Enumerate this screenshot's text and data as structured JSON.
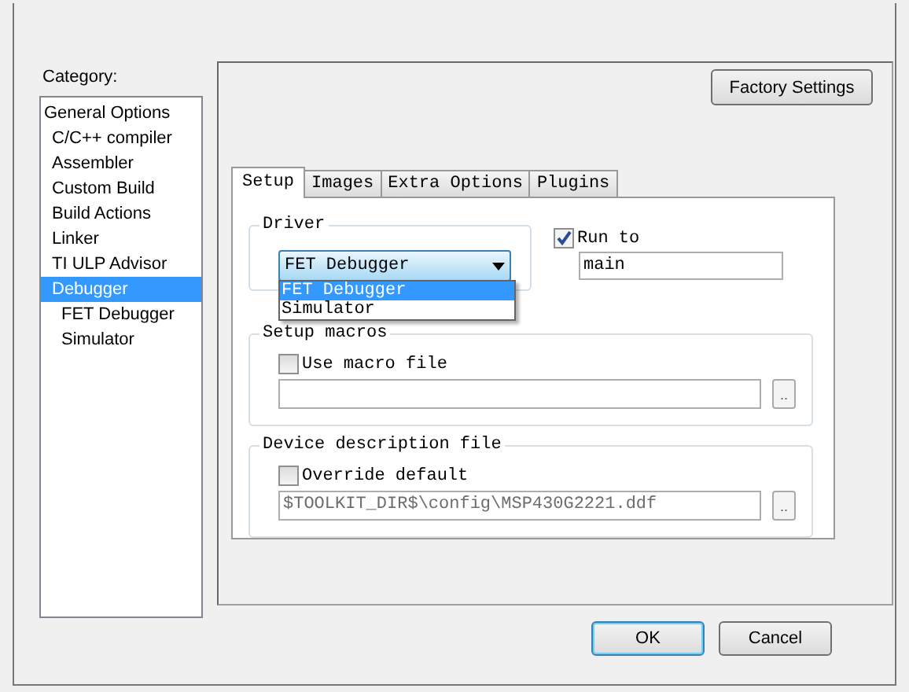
{
  "category": {
    "label": "Category:",
    "items": [
      {
        "label": "General Options",
        "selected": false,
        "children": [
          {
            "label": "C/C++ compiler",
            "selected": false
          },
          {
            "label": "Assembler",
            "selected": false
          },
          {
            "label": "Custom Build",
            "selected": false
          },
          {
            "label": "Build Actions",
            "selected": false
          },
          {
            "label": "Linker",
            "selected": false
          },
          {
            "label": "TI ULP Advisor",
            "selected": false
          },
          {
            "label": "Debugger",
            "selected": true,
            "children": [
              {
                "label": "FET Debugger",
                "selected": false
              },
              {
                "label": "Simulator",
                "selected": false
              }
            ]
          }
        ]
      }
    ]
  },
  "factory_button": "Factory Settings",
  "tabs": [
    {
      "label": "Setup",
      "selected": true
    },
    {
      "label": "Images",
      "selected": false
    },
    {
      "label": "Extra Options",
      "selected": false
    },
    {
      "label": "Plugins",
      "selected": false
    }
  ],
  "driver": {
    "legend": "Driver",
    "value": "FET Debugger",
    "options": [
      {
        "label": "FET Debugger",
        "selected": true
      },
      {
        "label": "Simulator",
        "selected": false
      }
    ]
  },
  "run_to": {
    "label": "Run to",
    "checked": true,
    "value": "main"
  },
  "setup_macros": {
    "legend": "Setup macros",
    "checkbox": {
      "label": "Use macro file",
      "checked": false
    },
    "browse": ".."
  },
  "device_description": {
    "legend": "Device description file",
    "checkbox": {
      "label": "Override default",
      "checked": false
    },
    "value": "$TOOLKIT_DIR$\\config\\MSP430G2221.ddf",
    "disabled": true,
    "browse": ".."
  },
  "buttons": [
    {
      "label": "OK",
      "default": true
    },
    {
      "label": "Cancel",
      "default": false
    }
  ]
}
